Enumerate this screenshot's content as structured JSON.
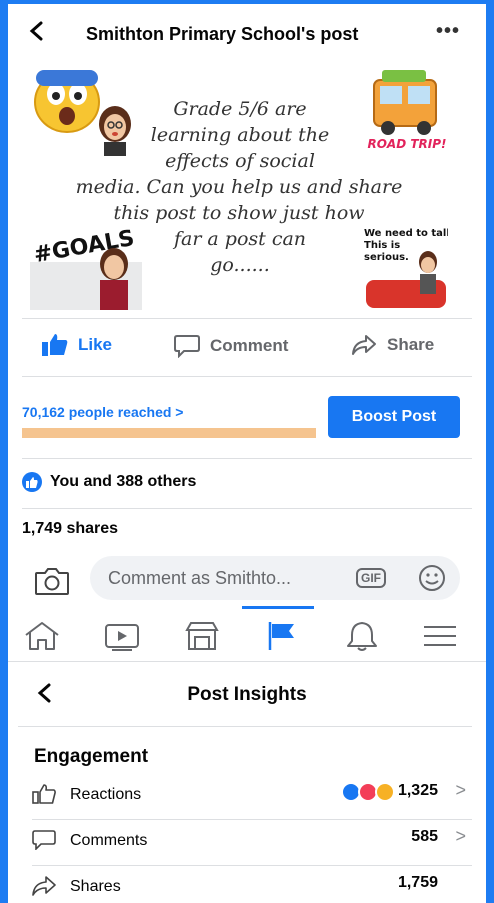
{
  "header": {
    "title": "Smithton Primary School's post",
    "more": "•••"
  },
  "post_image": {
    "text_lines": [
      "Grade 5/6 are",
      "learning about the",
      "effects of social",
      "media. Can you help us and share",
      "this post to show just how",
      "far a post can",
      "go......"
    ],
    "stickers": {
      "road_trip": "ROAD TRIP!",
      "goals": "#GOALS",
      "talk": "We need to talk. This is serious."
    }
  },
  "actions": {
    "like": "Like",
    "comment": "Comment",
    "share": "Share"
  },
  "reach": {
    "text": "70,162 people reached >",
    "boost": "Boost Post"
  },
  "likes": {
    "text": "You and 388 others"
  },
  "shares": {
    "text": "1,749 shares"
  },
  "comment_bar": {
    "placeholder": "Comment as Smithto...",
    "gif": "GIF"
  },
  "insights": {
    "title": "Post Insights",
    "section": "Engagement",
    "rows": [
      {
        "label": "Reactions",
        "value": "1,325",
        "chevron": ">"
      },
      {
        "label": "Comments",
        "value": "585",
        "chevron": ">"
      },
      {
        "label": "Shares",
        "value": "1,759"
      }
    ]
  },
  "colors": {
    "accent": "#1877f2",
    "frame": "#1d7cf2",
    "reach_bar": "#f5c48f"
  }
}
